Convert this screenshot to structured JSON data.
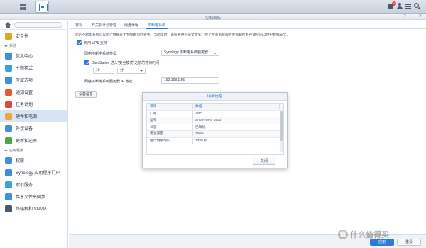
{
  "window": {
    "title": "控制面板"
  },
  "tray": {
    "notification_count": "1"
  },
  "sidebar": {
    "top_item": "安全性",
    "sections": [
      {
        "label": "系统",
        "items": [
          "信息中心",
          "主题样式",
          "区域选项",
          "通知设置",
          "任务计划",
          "硬件和电源",
          "外接设备",
          "更新和还原"
        ]
      },
      {
        "label": "应用程序",
        "items": [
          "权限",
          "Synology 应用程序门户",
          "索引服务",
          "共享文件夹同步",
          "终端机和 SNMP"
        ]
      }
    ],
    "active_item": "硬件和电源",
    "icon_colors": [
      "#e1a623",
      "#3f8fde",
      "#3aa3d8",
      "#3f8fde",
      "#e35a3a",
      "#e2463d",
      "#f2a33a",
      "#3f8fde",
      "#4aa845",
      "#3f8fde",
      "#3a8fd8",
      "#3aa3d8",
      "#3f8fde",
      "#4b5866"
    ]
  },
  "tabs": [
    "常规",
    "开关机计划管理",
    "硬盘休眠",
    "不断电系统"
  ],
  "active_tab": "不断电系统",
  "ups": {
    "description": "您的不断电系统可以防止数据在无预警断电时丢失。当断电时，系统将进入安全模式，停止所有系统服务并卸载所有存储空间以保护数据安全。",
    "enable_label": "启用 UPS 支持",
    "type_label": "网络不断电系统类型:",
    "type_value": "Synology 不断电系统服务器",
    "safe_mode_label": "DiskStation 进入\"安全模式\"之前的等待时间",
    "wait_value": "10",
    "wait_unit": "分",
    "server_ip_label": "网络不断电系统服务器 IP 地址:",
    "server_ip_value": "192.168.1.55",
    "device_info_button": "设备信息"
  },
  "modal": {
    "title": "详细信息",
    "columns": [
      "项目",
      "数值"
    ],
    "rows": [
      {
        "item": "厂商",
        "value": "APC"
      },
      {
        "item": "型号",
        "value": "Smart-UPS 1500"
      },
      {
        "item": "状态",
        "value": "已联机"
      },
      {
        "item": "电池容量",
        "value": "100%"
      },
      {
        "item": "估计剩余时间",
        "value": "7380 秒"
      }
    ],
    "close_button": "关闭"
  },
  "footer": {
    "apply_button": "应用",
    "reset_button": "重设"
  },
  "watermark": {
    "glyph": "值",
    "text": "什么值得买"
  }
}
